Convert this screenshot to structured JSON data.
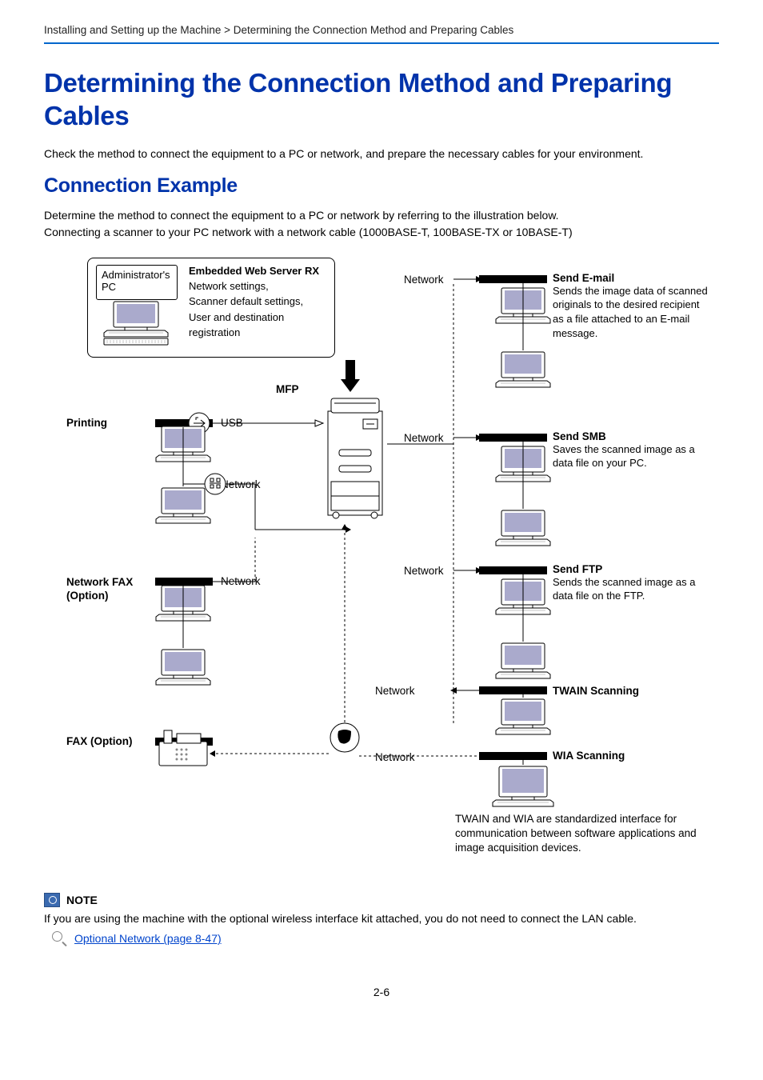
{
  "breadcrumb": "Installing and Setting up the Machine > Determining the Connection Method and Preparing Cables",
  "h1": "Determining the Connection Method and Preparing Cables",
  "intro": "Check the method to connect the equipment to a PC or network, and prepare the necessary cables for your environment.",
  "h2": "Connection Example",
  "p1": "Determine the method to connect the equipment to a PC or network by referring to the illustration below.",
  "p2": "Connecting a scanner to your PC network with a network cable (1000BASE-T, 100BASE-TX or 10BASE-T)",
  "diagram": {
    "admin_pc": "Administrator's PC",
    "ews_title": "Embedded Web Server RX",
    "ews_body": "Network settings,\nScanner default settings,\nUser and destination registration",
    "mfp": "MFP",
    "printing": "Printing",
    "usb": "USB",
    "network": "Network",
    "network_fax": "Network FAX (Option)",
    "fax": "FAX (Option)",
    "send_email_t": "Send E-mail",
    "send_email_b": "Sends the image data of scanned originals to the desired recipient as a file attached to an E-mail message.",
    "send_smb_t": "Send SMB",
    "send_smb_b": "Saves the scanned image as a data file on your PC.",
    "send_ftp_t": "Send FTP",
    "send_ftp_b": "Sends the scanned image as a data file on the FTP.",
    "twain_t": "TWAIN Scanning",
    "wia_t": "WIA Scanning",
    "twain_note": "TWAIN and WIA are standardized interface for communication between software applications and image acquisition devices."
  },
  "note": {
    "label": "NOTE",
    "text": "If you are using the machine with the optional wireless interface kit attached, you do not need to connect the LAN cable.",
    "link": "Optional Network (page 8-47)"
  },
  "page_num": "2-6"
}
